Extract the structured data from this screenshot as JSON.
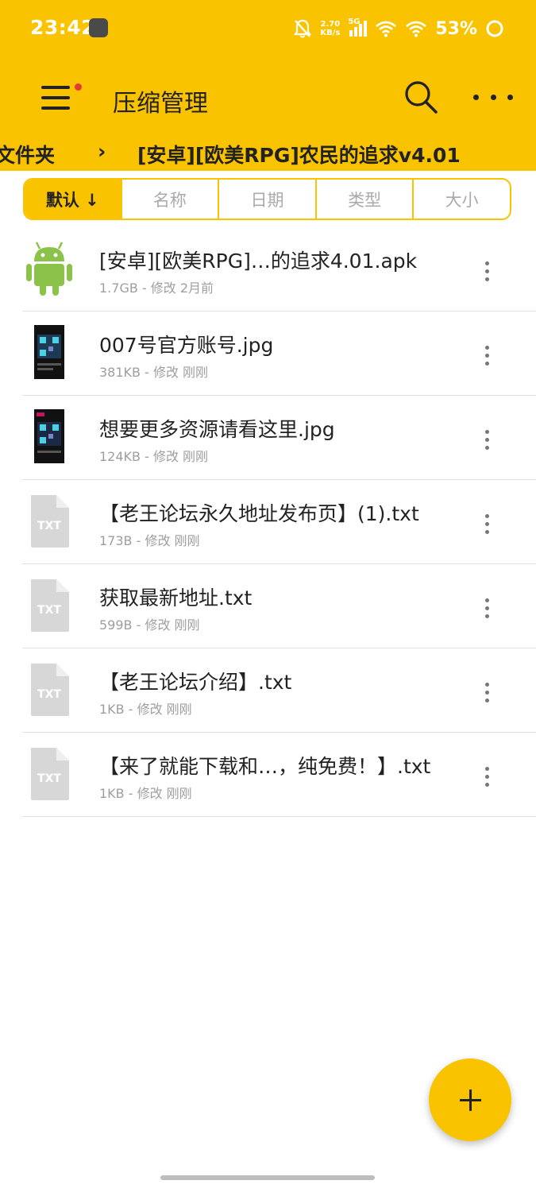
{
  "status_bar": {
    "time": "23:42",
    "net_speed_value": "2.70",
    "net_speed_unit": "KB/s",
    "network": "5G",
    "battery": "53%",
    "icons": [
      "avatar-icon",
      "bell-muted-icon",
      "signal-icon",
      "wifi-icon",
      "battery-ring-icon"
    ]
  },
  "toolbar": {
    "title": "压缩管理",
    "menu_icon": "hamburger-icon",
    "search_icon": "search-icon",
    "more_icon": "more-horizontal-icon"
  },
  "breadcrumb": {
    "previous": "文件夹",
    "separator": "›",
    "current": "[安卓][欧美RPG]农民的追求v4.01"
  },
  "sort_tabs": [
    {
      "label": "默认 ↓",
      "active": true
    },
    {
      "label": "名称",
      "active": false
    },
    {
      "label": "日期",
      "active": false
    },
    {
      "label": "类型",
      "active": false
    },
    {
      "label": "大小",
      "active": false
    }
  ],
  "files": [
    {
      "name": "[安卓][欧美RPG]…的追求4.01.apk",
      "meta": "1.7GB - 修改 2月前",
      "icon": "android-icon"
    },
    {
      "name": "007号官方账号.jpg",
      "meta": "381KB - 修改 刚刚",
      "icon": "image-thumbnail-icon"
    },
    {
      "name": "想要更多资源请看这里.jpg",
      "meta": "124KB - 修改 刚刚",
      "icon": "image-thumbnail-icon"
    },
    {
      "name": "【老王论坛永久地址发布页】(1).txt",
      "meta": "173B - 修改 刚刚",
      "icon": "txt-file-icon",
      "badge": "TXT"
    },
    {
      "name": "获取最新地址.txt",
      "meta": "599B - 修改 刚刚",
      "icon": "txt-file-icon",
      "badge": "TXT"
    },
    {
      "name": "【老王论坛介绍】.txt",
      "meta": "1KB - 修改 刚刚",
      "icon": "txt-file-icon",
      "badge": "TXT"
    },
    {
      "name": "【来了就能下载和…，纯免费！】.txt",
      "meta": "1KB - 修改 刚刚",
      "icon": "txt-file-icon",
      "badge": "TXT"
    }
  ],
  "fab": {
    "icon": "plus-icon"
  },
  "colors": {
    "accent": "#fac300",
    "text": "#222222",
    "secondary_text": "#9e9e9e",
    "android_green": "#8bc34a"
  }
}
